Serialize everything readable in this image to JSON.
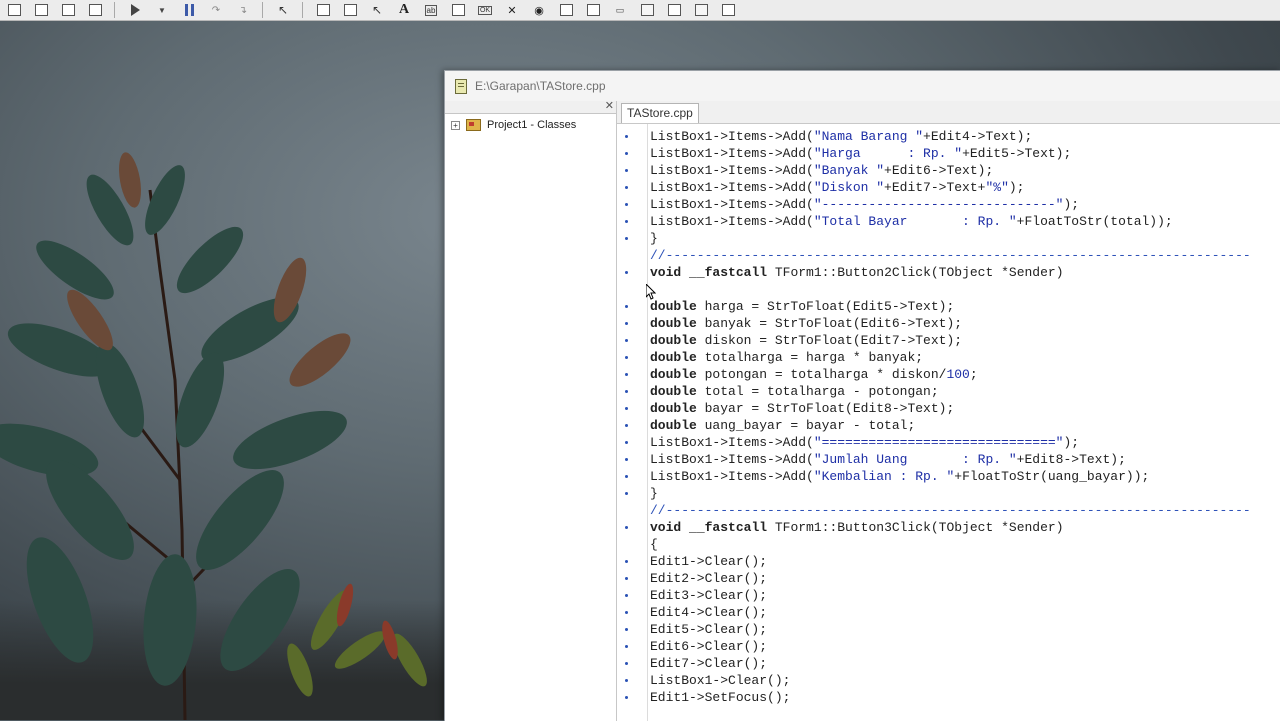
{
  "toolbar": {
    "icons": [
      "new-unit-icon",
      "new-form-icon",
      "save-all-icon",
      "open-project-icon",
      "run-icon",
      "run-dropdown-icon",
      "pause-icon",
      "step-over-icon",
      "trace-into-icon",
      "pointer-icon",
      "frame-icon",
      "main-menu-icon",
      "popup-menu-icon",
      "label-icon",
      "edit-icon",
      "memo-icon",
      "button-icon",
      "checkbox-icon",
      "radiobutton-icon",
      "listbox-icon",
      "combobox-icon",
      "scrollbar-icon",
      "groupbox-icon",
      "radiogroup-icon",
      "panel-icon",
      "actionlist-icon"
    ]
  },
  "window": {
    "title": "E:\\Garapan\\TAStore.cpp"
  },
  "explorer": {
    "tree_item": "Project1 - Classes",
    "expand_glyph": "+"
  },
  "editor": {
    "tab_label": "TAStore.cpp",
    "lines": [
      {
        "bp": true,
        "text": "ListBox1->Items->Add(\"Nama Barang \"+Edit4->Text);"
      },
      {
        "bp": true,
        "text": "ListBox1->Items->Add(\"Harga      : Rp. \"+Edit5->Text);"
      },
      {
        "bp": true,
        "text": "ListBox1->Items->Add(\"Banyak \"+Edit6->Text);"
      },
      {
        "bp": true,
        "text": "ListBox1->Items->Add(\"Diskon \"+Edit7->Text+\"%\");"
      },
      {
        "bp": true,
        "text": "ListBox1->Items->Add(\"------------------------------\");"
      },
      {
        "bp": true,
        "text": "ListBox1->Items->Add(\"Total Bayar       : Rp. \"+FloatToStr(total));"
      },
      {
        "bp": true,
        "text": "}"
      },
      {
        "bp": false,
        "text": "//---------------------------------------------------------------------------"
      },
      {
        "bp": true,
        "text": "void __fastcall TForm1::Button2Click(TObject *Sender)"
      },
      {
        "bp": false,
        "text": ""
      },
      {
        "bp": true,
        "text": "double harga = StrToFloat(Edit5->Text);"
      },
      {
        "bp": true,
        "text": "double banyak = StrToFloat(Edit6->Text);"
      },
      {
        "bp": true,
        "text": "double diskon = StrToFloat(Edit7->Text);"
      },
      {
        "bp": true,
        "text": "double totalharga = harga * banyak;"
      },
      {
        "bp": true,
        "text": "double potongan = totalharga * diskon/100;"
      },
      {
        "bp": true,
        "text": "double total = totalharga - potongan;"
      },
      {
        "bp": true,
        "text": "double bayar = StrToFloat(Edit8->Text);"
      },
      {
        "bp": true,
        "text": "double uang_bayar = bayar - total;"
      },
      {
        "bp": true,
        "text": "ListBox1->Items->Add(\"==============================\");"
      },
      {
        "bp": true,
        "text": "ListBox1->Items->Add(\"Jumlah Uang       : Rp. \"+Edit8->Text);"
      },
      {
        "bp": true,
        "text": "ListBox1->Items->Add(\"Kembalian : Rp. \"+FloatToStr(uang_bayar));"
      },
      {
        "bp": true,
        "text": "}"
      },
      {
        "bp": false,
        "text": "//---------------------------------------------------------------------------"
      },
      {
        "bp": true,
        "text": "void __fastcall TForm1::Button3Click(TObject *Sender)"
      },
      {
        "bp": false,
        "text": "{"
      },
      {
        "bp": true,
        "text": "Edit1->Clear();"
      },
      {
        "bp": true,
        "text": "Edit2->Clear();"
      },
      {
        "bp": true,
        "text": "Edit3->Clear();"
      },
      {
        "bp": true,
        "text": "Edit4->Clear();"
      },
      {
        "bp": true,
        "text": "Edit5->Clear();"
      },
      {
        "bp": true,
        "text": "Edit6->Clear();"
      },
      {
        "bp": true,
        "text": "Edit7->Clear();"
      },
      {
        "bp": true,
        "text": "ListBox1->Clear();"
      },
      {
        "bp": true,
        "text": "Edit1->SetFocus();"
      }
    ]
  },
  "colors": {
    "string": "#1e2fa6",
    "comment": "#2e52b8",
    "breakpoint_dot": "#2b52b5"
  }
}
